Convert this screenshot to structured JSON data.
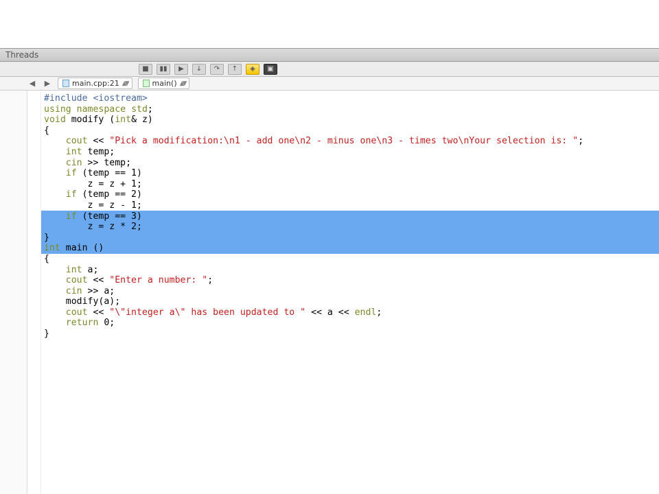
{
  "titlebar": {
    "label": "Threads"
  },
  "toolbar": {
    "buttons": [
      "stop",
      "pause",
      "play",
      "step-in",
      "step-over",
      "step-out",
      "breakpoints",
      "panel"
    ]
  },
  "tabs": {
    "nav_back": "◀",
    "nav_fwd": "▶",
    "items": [
      {
        "label": "main.cpp:21"
      },
      {
        "label": "main()"
      }
    ]
  },
  "code": {
    "lines": [
      {
        "t": "#include <iostream>",
        "cls": "pp"
      },
      {
        "t": "using namespace std;",
        "cls": "kw"
      },
      {
        "t": "",
        "cls": ""
      },
      {
        "t": "void modify (int& z)",
        "cls": "kw"
      },
      {
        "t": "{",
        "cls": ""
      },
      {
        "t": "    cout << \"Pick a modification:\\n1 - add one\\n2 - minus one\\n3 - times two\\nYour selection is: \";",
        "cls": "mix"
      },
      {
        "t": "    int temp;",
        "cls": "kw"
      },
      {
        "t": "    cin >> temp;",
        "cls": ""
      },
      {
        "t": "",
        "cls": ""
      },
      {
        "t": "    if (temp == 1)",
        "cls": "kw"
      },
      {
        "t": "        z = z + 1;",
        "cls": ""
      },
      {
        "t": "    if (temp == 2)",
        "cls": "kw",
        "sel": true
      },
      {
        "t": "        z = z - 1;",
        "cls": "",
        "sel": true
      },
      {
        "t": "    if (temp == 3)",
        "cls": "kw",
        "sel": true
      },
      {
        "t": "        z = z * 2;",
        "cls": "",
        "sel": true
      },
      {
        "t": "}",
        "cls": ""
      },
      {
        "t": "",
        "cls": ""
      },
      {
        "t": "int main ()",
        "cls": "kw"
      },
      {
        "t": "{",
        "cls": ""
      },
      {
        "t": "    int a;",
        "cls": "kw"
      },
      {
        "t": "    cout << \"Enter a number: \";",
        "cls": "mix"
      },
      {
        "t": "    cin >> a;",
        "cls": ""
      },
      {
        "t": "    modify(a);",
        "cls": ""
      },
      {
        "t": "    cout << \"\\\"integer a\\\" has been updated to \" << a << endl;",
        "cls": "mix"
      },
      {
        "t": "",
        "cls": ""
      },
      {
        "t": "    return 0;",
        "cls": "kw"
      },
      {
        "t": "}",
        "cls": ""
      }
    ]
  }
}
